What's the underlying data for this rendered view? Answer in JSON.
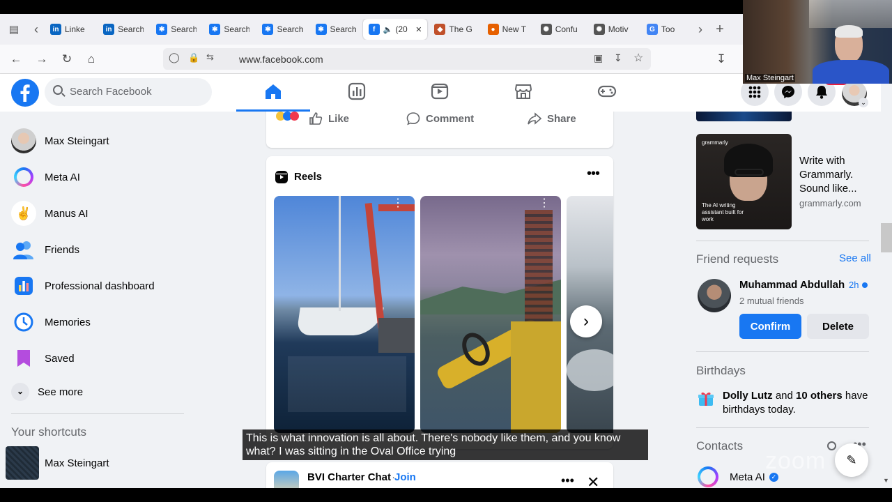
{
  "browser": {
    "tabs": [
      {
        "label": "Linke",
        "icon": "linkedin-icon",
        "color": "#0a66c2",
        "glyph": "in"
      },
      {
        "label": "Search",
        "icon": "linkedin-icon",
        "color": "#0a66c2",
        "glyph": "in"
      },
      {
        "label": "Search",
        "icon": "compass-icon",
        "color": "#1877f2",
        "glyph": "✱"
      },
      {
        "label": "Search",
        "icon": "compass-icon",
        "color": "#1877f2",
        "glyph": "✱"
      },
      {
        "label": "Search",
        "icon": "compass-icon",
        "color": "#1877f2",
        "glyph": "✱"
      },
      {
        "label": "Search",
        "icon": "compass-icon",
        "color": "#1877f2",
        "glyph": "✱"
      },
      {
        "label": "(20",
        "icon": "facebook-icon",
        "color": "#1877f2",
        "glyph": "f",
        "active": true
      },
      {
        "label": "The G",
        "icon": "site-icon",
        "color": "#c0502a",
        "glyph": "◆"
      },
      {
        "label": "New T",
        "icon": "firefox-icon",
        "color": "#e66000",
        "glyph": "●"
      },
      {
        "label": "Confu",
        "icon": "chatgpt-icon",
        "color": "#555555",
        "glyph": "✺"
      },
      {
        "label": "Motiv",
        "icon": "chatgpt-icon",
        "color": "#555555",
        "glyph": "✺"
      },
      {
        "label": "Too",
        "icon": "google-icon",
        "color": "#4285f4",
        "glyph": "G"
      }
    ],
    "url": "www.facebook.com"
  },
  "header": {
    "search_placeholder": "Search Facebook"
  },
  "left": {
    "items": [
      {
        "label": "Max Steingart",
        "icon": "avatar"
      },
      {
        "label": "Meta AI",
        "icon": "meta-ai-icon"
      },
      {
        "label": "Manus AI",
        "icon": "manus-icon"
      },
      {
        "label": "Friends",
        "icon": "friends-icon"
      },
      {
        "label": "Professional dashboard",
        "icon": "dashboard-icon"
      },
      {
        "label": "Memories",
        "icon": "memories-icon"
      },
      {
        "label": "Saved",
        "icon": "saved-icon"
      }
    ],
    "see_more": "See more",
    "shortcuts_title": "Your shortcuts",
    "shortcut": "Max Steingart"
  },
  "post_actions": {
    "like": "Like",
    "comment": "Comment",
    "share": "Share"
  },
  "reels": {
    "title": "Reels"
  },
  "next_post": {
    "group": "BVI Charter Chat",
    "sep": " · ",
    "join": "Join"
  },
  "ad": {
    "line1": "Write with",
    "line2": "Grammarly.",
    "line3": "Sound like...",
    "domain": "grammarly.com",
    "brand": "grammarly",
    "tagline": "The AI writing assistant built for work"
  },
  "friend_requests": {
    "title": "Friend requests",
    "see_all": "See all",
    "name": "Muhammad Abdullah",
    "time": "2h",
    "mutual": "2 mutual friends",
    "confirm": "Confirm",
    "delete": "Delete"
  },
  "birthdays": {
    "title": "Birthdays",
    "name": "Dolly Lutz",
    "and": " and ",
    "others": "10 others",
    "rest": " have birthdays today."
  },
  "contacts": {
    "title": "Contacts",
    "first": "Meta AI"
  },
  "subtitle": {
    "line1": "This is what innovation is all about. There's nobody like them, and you know",
    "line2": "what? I was sitting in the Oval Office trying"
  },
  "zoom": {
    "name": "Max Steingart",
    "watermark": "zoom"
  },
  "colors": {
    "fb_blue": "#1877f2",
    "fb_bg": "#f0f2f5"
  }
}
